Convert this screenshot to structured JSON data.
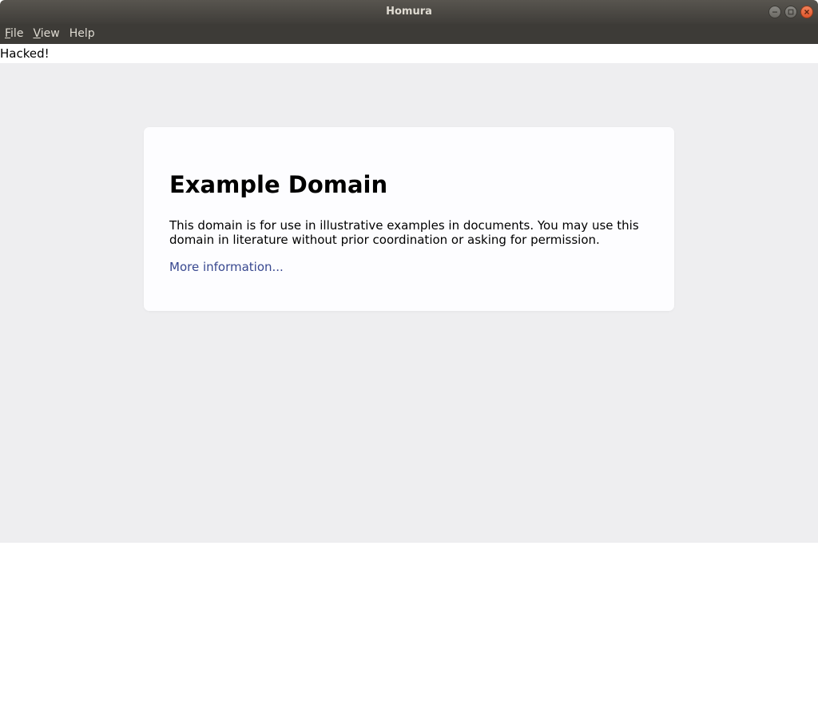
{
  "window": {
    "title": "Homura",
    "controls": {
      "minimize": "minimize-icon",
      "maximize": "maximize-icon",
      "close": "close-icon"
    }
  },
  "menubar": {
    "items": [
      {
        "label_underlined": "F",
        "label_rest": "ile"
      },
      {
        "label_underlined": "V",
        "label_rest": "iew"
      },
      {
        "label_underlined": "",
        "label_rest": "Help"
      }
    ]
  },
  "injected_text": "Hacked!",
  "page": {
    "heading": "Example Domain",
    "description": "This domain is for use in illustrative examples in documents. You may use this domain in literature without prior coordination or asking for permission.",
    "link_text": "More information..."
  },
  "colors": {
    "titlebar": "#4a4844",
    "menubar": "#3d3b37",
    "page_background": "#eeeef0",
    "card_background": "#fdfdff",
    "link": "#38488f",
    "close_button": "#e95420"
  }
}
